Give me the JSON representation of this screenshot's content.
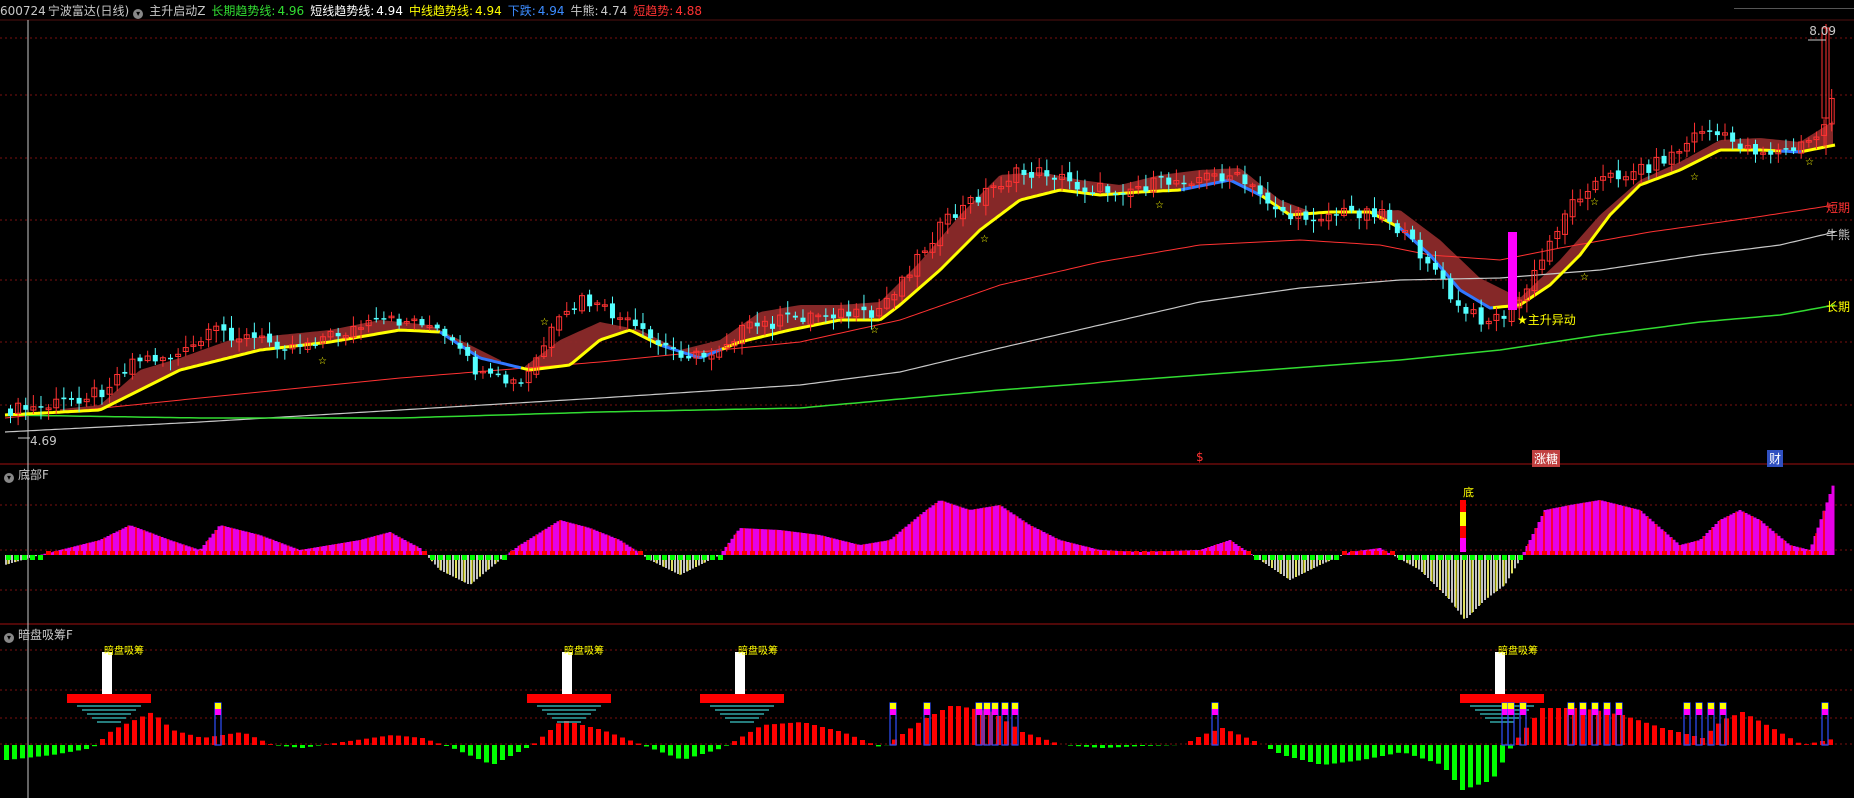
{
  "header": {
    "code": "600724",
    "name": "宁波富达(日线)",
    "indicator": "主升启动Z",
    "long_label": "长期趋势线:",
    "long_val": "4.96",
    "short_label": "短线趋势线:",
    "short_val": "4.94",
    "mid_label": "中线趋势线:",
    "mid_val": "4.94",
    "down_label": "下跌:",
    "down_val": "4.94",
    "bear_label": "牛熊:",
    "bear_val": "4.74",
    "sht_label": "短趋势:",
    "sht_val": "4.88"
  },
  "main_panel": {
    "high_label": "8.09",
    "low_label": "4.69",
    "line_labels": {
      "short": "短期",
      "bull": "牛熊",
      "long": "长期"
    },
    "signal_text": "主升异动",
    "events": [
      "$",
      "涨糖",
      "财"
    ]
  },
  "panel2": {
    "title": "底部F",
    "marker": "底"
  },
  "panel3": {
    "title": "暗盘吸筹F",
    "tag": "暗盘吸筹"
  },
  "colors": {
    "up": "#ff3232",
    "down": "#54ffff",
    "short": "#ff3232",
    "bull": "#c8c8c8",
    "long": "#32dc32",
    "yellow": "#ffff00",
    "blue": "#3278ff",
    "band": "#8c2a2a",
    "magenta": "#ff00ff",
    "green": "#00ff00",
    "red": "#ff0000"
  },
  "chart_data": [
    {
      "type": "candlestick",
      "title": "600724 宁波富达(日线)",
      "ylim": [
        4.69,
        8.09
      ],
      "annotations": [
        "主升异动",
        "$",
        "涨糖",
        "财"
      ],
      "series": [
        {
          "name": "短期"
        },
        {
          "name": "牛熊"
        },
        {
          "name": "长期"
        },
        {
          "name": "短线趋势线",
          "last": 4.94
        },
        {
          "name": "中线趋势线",
          "last": 4.94
        },
        {
          "name": "长期趋势线",
          "last": 4.96
        },
        {
          "name": "下跌",
          "last": 4.94
        },
        {
          "name": "短趋势",
          "last": 4.88
        },
        {
          "name": "牛熊",
          "last": 4.74
        }
      ]
    },
    {
      "type": "bar",
      "title": "底部F"
    },
    {
      "type": "bar",
      "title": "暗盘吸筹F"
    }
  ]
}
